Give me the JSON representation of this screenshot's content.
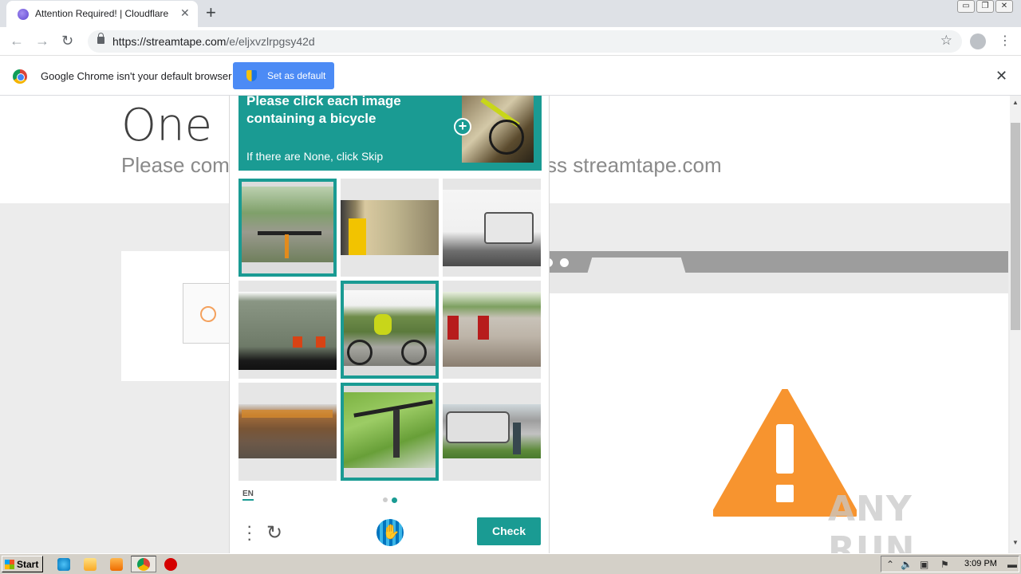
{
  "browser": {
    "tab_title": "Attention Required! | Cloudflare",
    "tab_close": "✕",
    "new_tab": "+",
    "url_host": "https://streamtape.com",
    "url_path": "/e/eljxvzlrpgsy42d"
  },
  "infobar": {
    "message": "Google Chrome isn't your default browser",
    "button_label": "Set as default",
    "close": "✕"
  },
  "page": {
    "heading": "One m",
    "subheading_left": "Please com",
    "subheading_right": "ss streamtape.com"
  },
  "captcha": {
    "prompt_line1": "Please click each image",
    "prompt_line2": "containing a bicycle",
    "prompt_hint": "If there are None, click Skip",
    "language": "EN",
    "check_label": "Check",
    "page_dots": 2,
    "active_page": 2,
    "tiles": [
      {
        "subject": "bicycle handlebars on road",
        "selected": true
      },
      {
        "subject": "subway train at platform",
        "selected": false
      },
      {
        "subject": "white bus",
        "selected": false
      },
      {
        "subject": "truck trailer",
        "selected": false
      },
      {
        "subject": "cyclist on road bike",
        "selected": true
      },
      {
        "subject": "red train",
        "selected": false
      },
      {
        "subject": "transport truck",
        "selected": false
      },
      {
        "subject": "bicycle handlebar on grass",
        "selected": true
      },
      {
        "subject": "tour bus",
        "selected": false
      }
    ]
  },
  "watermark": "ANY RUN",
  "taskbar": {
    "start_label": "Start",
    "clock": "3:09 PM"
  },
  "colors": {
    "accent_teal": "#1a9b93",
    "chrome_blue": "#4c8bf5",
    "warning_orange": "#f7942f"
  }
}
